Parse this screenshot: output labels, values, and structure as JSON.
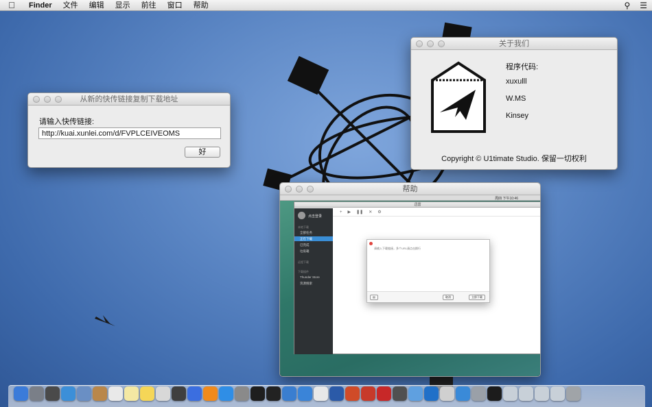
{
  "menubar": {
    "app_name": "Finder",
    "items": [
      "文件",
      "编辑",
      "显示",
      "前往",
      "窗口",
      "帮助"
    ]
  },
  "link_dialog": {
    "title": "从新的快传链接复制下载地址",
    "prompt": "请输入快传链接:",
    "url_value": "http://kuai.xunlei.com/d/FVPLCEIVEOMS",
    "ok_label": "好"
  },
  "about_dialog": {
    "title": "关于我们",
    "credit_label": "程序代码:",
    "credits": [
      "xuxulll",
      "W.MS",
      "Kinsey"
    ],
    "copyright": "Copyright © U1timate Studio. 保留一切权利"
  },
  "help_window": {
    "title": "帮助",
    "embedded": {
      "menubar_time": "周四 下午10:46",
      "app_title": "迅雷",
      "user_name": "点击登录",
      "section_local": "本地下载",
      "items": [
        "全部任务",
        "正在下载",
        "已完成",
        "垃圾箱"
      ],
      "section_remote": "远程下载",
      "section_apps": "下载插件",
      "apps": [
        "Thunder Store",
        "资源搜索"
      ],
      "dialog_hint": "请输入下载链接，多个URL请点击换行",
      "cancel_label": "取消",
      "download_label": "立即下载"
    }
  },
  "dock": {
    "icons": [
      "finder-icon",
      "launchpad-icon",
      "mission-control-icon",
      "safari-icon",
      "preview-icon",
      "contacts-icon",
      "calendar-icon",
      "notes-icon",
      "stickies-icon",
      "photos-icon",
      "facetime-icon",
      "itunes-icon",
      "ibooks-icon",
      "app-store-icon",
      "system-preferences-icon",
      "terminal-icon",
      "qq-icon",
      "xcode-icon",
      "thunder-icon",
      "chrome-icon",
      "word-icon",
      "powerpoint-icon",
      "wps-icon",
      "filezilla-icon",
      "net-icon",
      "maps-icon",
      "teamviewer-icon",
      "utility-icon",
      "time-machine-icon",
      "help-icon",
      "music-icon",
      "downloads-icon",
      "documents-icon",
      "desktop-icon",
      "folder-icon",
      "trash-icon"
    ]
  }
}
